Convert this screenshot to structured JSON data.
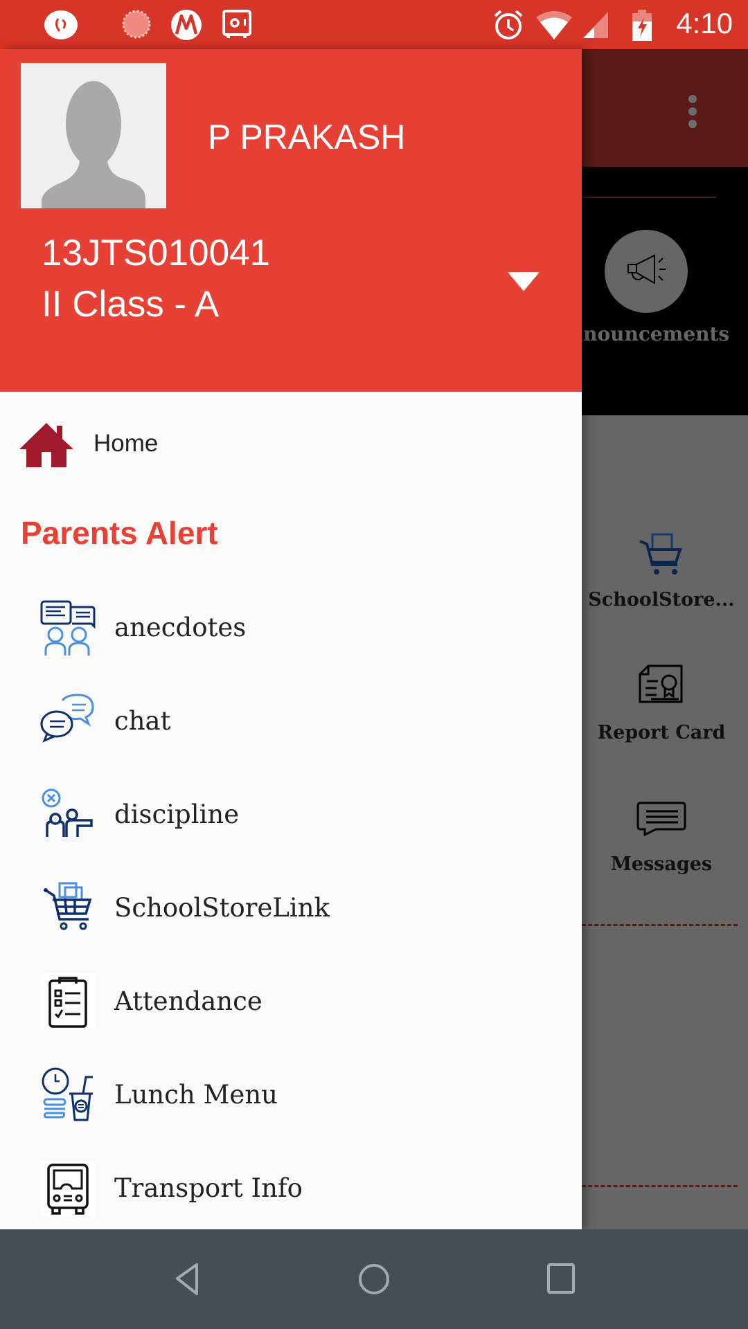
{
  "status_bar": {
    "time": "4:10",
    "left_icons": [
      "app-notification-icon",
      "loading-icon",
      "motorola-icon",
      "safe-icon"
    ],
    "right_icons": [
      "alarm-icon",
      "wifi-icon",
      "signal-icon",
      "battery-charging-icon"
    ]
  },
  "drawer": {
    "user": {
      "name": "P PRAKASH",
      "id": "13JTS010041",
      "class": "II Class - A"
    },
    "home_label": "Home",
    "section_title": "Parents Alert",
    "items": [
      {
        "label": "anecdotes",
        "icon": "anecdotes-icon"
      },
      {
        "label": "chat",
        "icon": "chat-icon"
      },
      {
        "label": "discipline",
        "icon": "discipline-icon"
      },
      {
        "label": "SchoolStoreLink",
        "icon": "shopping-cart-icon"
      },
      {
        "label": "Attendance",
        "icon": "clipboard-checklist-icon"
      },
      {
        "label": "Lunch Menu",
        "icon": "lunch-menu-icon"
      },
      {
        "label": "Transport Info",
        "icon": "bus-icon"
      }
    ]
  },
  "background": {
    "announcements_label": "Announcements",
    "tiles": [
      {
        "label": "SchoolStore...",
        "icon": "shopping-cart-icon"
      },
      {
        "label": "Report Card",
        "icon": "certificate-icon"
      },
      {
        "label": "Messages",
        "icon": "message-icon"
      }
    ]
  },
  "nav_bar": {
    "buttons": [
      "back",
      "home",
      "recents"
    ]
  },
  "colors": {
    "status_bar": "#d73527",
    "header": "#e64134",
    "accent": "#e64134",
    "home_icon": "#a01a2c",
    "icon_dark_blue": "#0d2f6b",
    "icon_light_blue": "#4a8fe0",
    "nav_bar": "#464d53"
  }
}
